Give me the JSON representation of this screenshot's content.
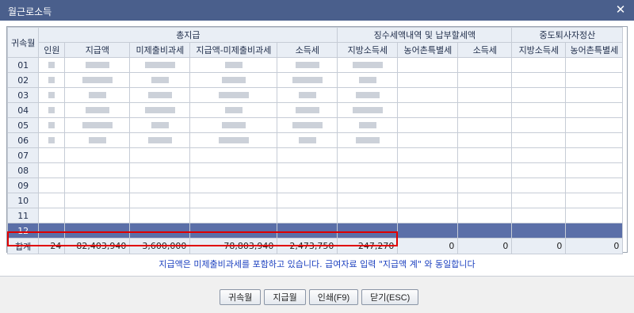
{
  "window": {
    "title": "월근로소득",
    "close_icon": "close-icon"
  },
  "table": {
    "group_headers": {
      "month": "귀속월",
      "total_pay": "총지급",
      "tax_details": "징수세액내역 및 납부할세액",
      "midterm": "중도퇴사자정산"
    },
    "sub_headers": [
      "인원",
      "지급액",
      "미제출비과세",
      "지급액-미제출비과세",
      "소득세",
      "지방소득세",
      "농어촌특별세",
      "소득세",
      "지방소득세",
      "농어촌특별세"
    ],
    "months": [
      "01",
      "02",
      "03",
      "04",
      "05",
      "06",
      "07",
      "08",
      "09",
      "10",
      "11",
      "12"
    ],
    "selected_month": "12",
    "total": {
      "label": "합계",
      "headcount": "24",
      "pay": "82,403,940",
      "nontax": "3,600,000",
      "pay_minus_nontax": "78,803,940",
      "income_tax": "2,473,750",
      "local_tax": "247,270",
      "rural_tax": "0",
      "mid_income_tax": "0",
      "mid_local_tax": "0",
      "mid_rural_tax": "0"
    }
  },
  "note": "지급액은 미제출비과세를 포함하고 있습니다. 급여자료 입력 \"지급액 계\" 와 동일합니다",
  "buttons": {
    "month": "귀속월",
    "payment_month": "지급월",
    "print": "인쇄(F9)",
    "close": "닫기(ESC)"
  }
}
